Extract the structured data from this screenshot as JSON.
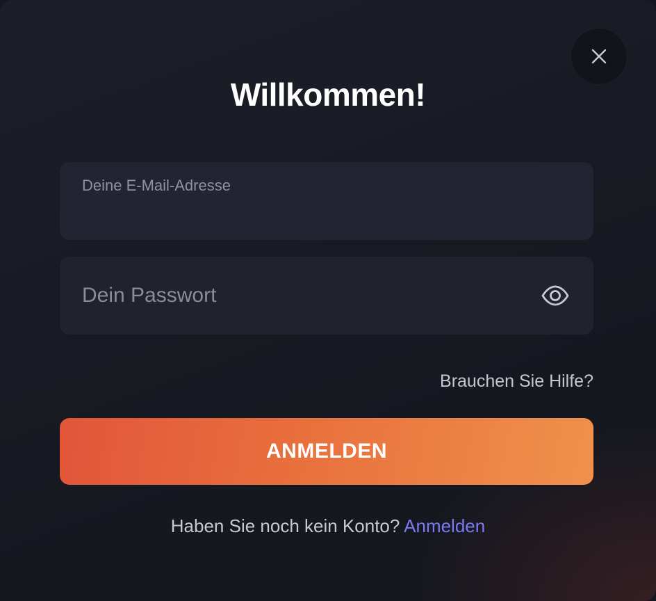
{
  "modal": {
    "title": "Willkommen!",
    "close_icon": "close-icon"
  },
  "email": {
    "label": "Deine E-Mail-Adresse",
    "value": ""
  },
  "password": {
    "placeholder": "Dein Passwort",
    "value": "",
    "toggle_icon": "eye-icon"
  },
  "help": {
    "label": "Brauchen Sie Hilfe?"
  },
  "submit": {
    "label": "ANMELDEN"
  },
  "signup": {
    "prompt": "Haben Sie noch kein Konto?",
    "link_label": "Anmelden"
  },
  "colors": {
    "accent_gradient_start": "#e2553a",
    "accent_gradient_end": "#f0914c",
    "link": "#7b79f3",
    "background": "#181a23"
  }
}
